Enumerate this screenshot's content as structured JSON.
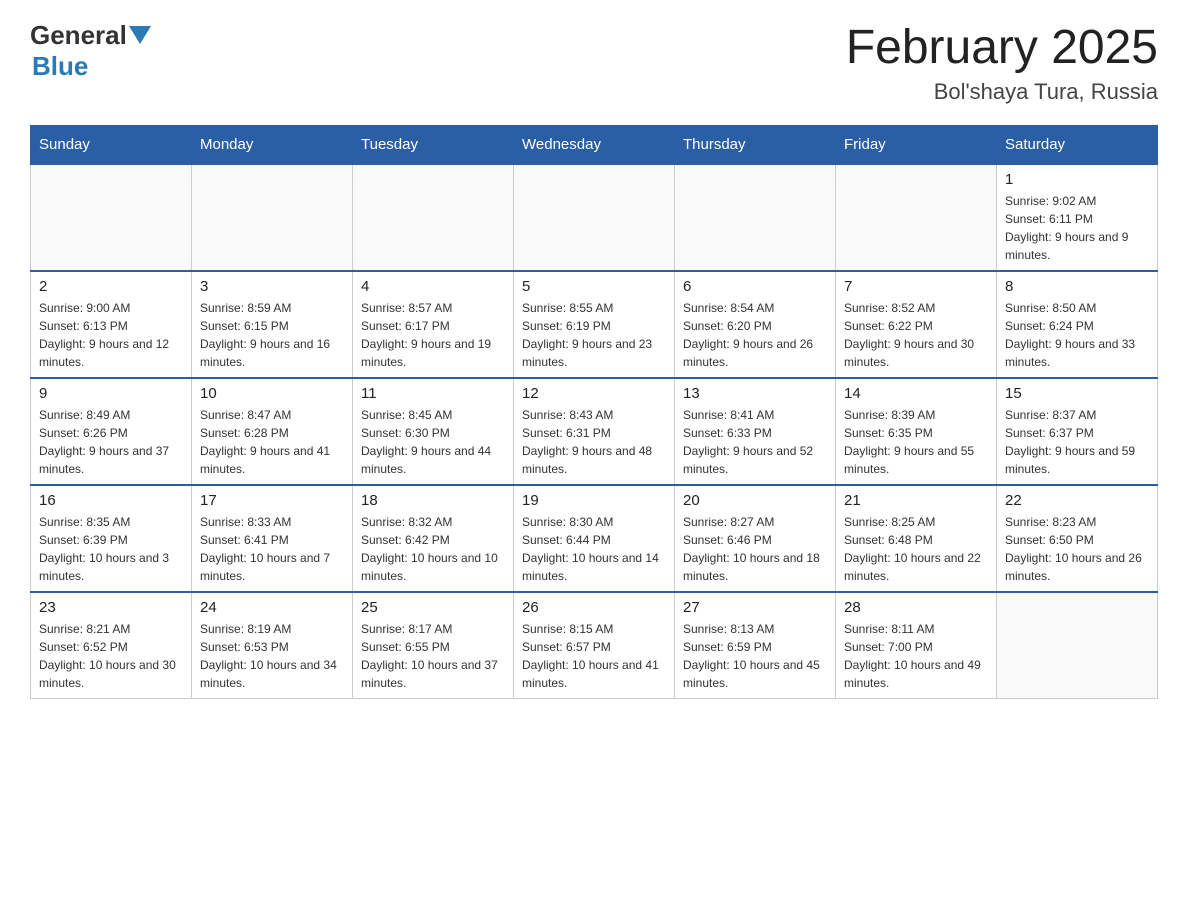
{
  "header": {
    "logo_general": "General",
    "logo_blue": "Blue",
    "month_title": "February 2025",
    "location": "Bol'shaya Tura, Russia"
  },
  "days_of_week": [
    "Sunday",
    "Monday",
    "Tuesday",
    "Wednesday",
    "Thursday",
    "Friday",
    "Saturday"
  ],
  "weeks": [
    [
      {
        "day": "",
        "info": ""
      },
      {
        "day": "",
        "info": ""
      },
      {
        "day": "",
        "info": ""
      },
      {
        "day": "",
        "info": ""
      },
      {
        "day": "",
        "info": ""
      },
      {
        "day": "",
        "info": ""
      },
      {
        "day": "1",
        "info": "Sunrise: 9:02 AM\nSunset: 6:11 PM\nDaylight: 9 hours and 9 minutes."
      }
    ],
    [
      {
        "day": "2",
        "info": "Sunrise: 9:00 AM\nSunset: 6:13 PM\nDaylight: 9 hours and 12 minutes."
      },
      {
        "day": "3",
        "info": "Sunrise: 8:59 AM\nSunset: 6:15 PM\nDaylight: 9 hours and 16 minutes."
      },
      {
        "day": "4",
        "info": "Sunrise: 8:57 AM\nSunset: 6:17 PM\nDaylight: 9 hours and 19 minutes."
      },
      {
        "day": "5",
        "info": "Sunrise: 8:55 AM\nSunset: 6:19 PM\nDaylight: 9 hours and 23 minutes."
      },
      {
        "day": "6",
        "info": "Sunrise: 8:54 AM\nSunset: 6:20 PM\nDaylight: 9 hours and 26 minutes."
      },
      {
        "day": "7",
        "info": "Sunrise: 8:52 AM\nSunset: 6:22 PM\nDaylight: 9 hours and 30 minutes."
      },
      {
        "day": "8",
        "info": "Sunrise: 8:50 AM\nSunset: 6:24 PM\nDaylight: 9 hours and 33 minutes."
      }
    ],
    [
      {
        "day": "9",
        "info": "Sunrise: 8:49 AM\nSunset: 6:26 PM\nDaylight: 9 hours and 37 minutes."
      },
      {
        "day": "10",
        "info": "Sunrise: 8:47 AM\nSunset: 6:28 PM\nDaylight: 9 hours and 41 minutes."
      },
      {
        "day": "11",
        "info": "Sunrise: 8:45 AM\nSunset: 6:30 PM\nDaylight: 9 hours and 44 minutes."
      },
      {
        "day": "12",
        "info": "Sunrise: 8:43 AM\nSunset: 6:31 PM\nDaylight: 9 hours and 48 minutes."
      },
      {
        "day": "13",
        "info": "Sunrise: 8:41 AM\nSunset: 6:33 PM\nDaylight: 9 hours and 52 minutes."
      },
      {
        "day": "14",
        "info": "Sunrise: 8:39 AM\nSunset: 6:35 PM\nDaylight: 9 hours and 55 minutes."
      },
      {
        "day": "15",
        "info": "Sunrise: 8:37 AM\nSunset: 6:37 PM\nDaylight: 9 hours and 59 minutes."
      }
    ],
    [
      {
        "day": "16",
        "info": "Sunrise: 8:35 AM\nSunset: 6:39 PM\nDaylight: 10 hours and 3 minutes."
      },
      {
        "day": "17",
        "info": "Sunrise: 8:33 AM\nSunset: 6:41 PM\nDaylight: 10 hours and 7 minutes."
      },
      {
        "day": "18",
        "info": "Sunrise: 8:32 AM\nSunset: 6:42 PM\nDaylight: 10 hours and 10 minutes."
      },
      {
        "day": "19",
        "info": "Sunrise: 8:30 AM\nSunset: 6:44 PM\nDaylight: 10 hours and 14 minutes."
      },
      {
        "day": "20",
        "info": "Sunrise: 8:27 AM\nSunset: 6:46 PM\nDaylight: 10 hours and 18 minutes."
      },
      {
        "day": "21",
        "info": "Sunrise: 8:25 AM\nSunset: 6:48 PM\nDaylight: 10 hours and 22 minutes."
      },
      {
        "day": "22",
        "info": "Sunrise: 8:23 AM\nSunset: 6:50 PM\nDaylight: 10 hours and 26 minutes."
      }
    ],
    [
      {
        "day": "23",
        "info": "Sunrise: 8:21 AM\nSunset: 6:52 PM\nDaylight: 10 hours and 30 minutes."
      },
      {
        "day": "24",
        "info": "Sunrise: 8:19 AM\nSunset: 6:53 PM\nDaylight: 10 hours and 34 minutes."
      },
      {
        "day": "25",
        "info": "Sunrise: 8:17 AM\nSunset: 6:55 PM\nDaylight: 10 hours and 37 minutes."
      },
      {
        "day": "26",
        "info": "Sunrise: 8:15 AM\nSunset: 6:57 PM\nDaylight: 10 hours and 41 minutes."
      },
      {
        "day": "27",
        "info": "Sunrise: 8:13 AM\nSunset: 6:59 PM\nDaylight: 10 hours and 45 minutes."
      },
      {
        "day": "28",
        "info": "Sunrise: 8:11 AM\nSunset: 7:00 PM\nDaylight: 10 hours and 49 minutes."
      },
      {
        "day": "",
        "info": ""
      }
    ]
  ]
}
